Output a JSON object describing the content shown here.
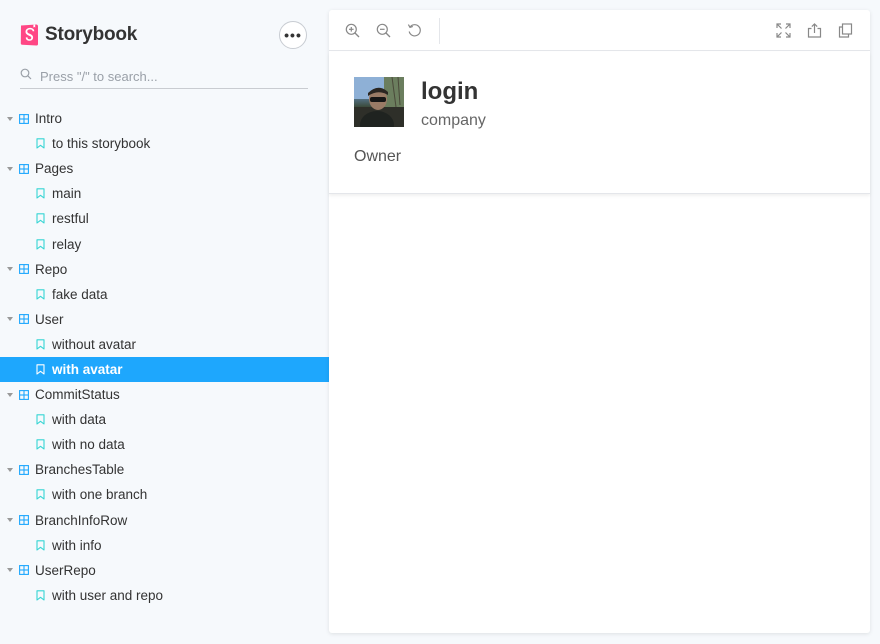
{
  "brand": {
    "title": "Storybook",
    "color": "#ff4785"
  },
  "menu": {
    "label": "•••"
  },
  "search": {
    "placeholder": "Press \"/\" to search..."
  },
  "accent": "#1ea7fd",
  "tree": [
    {
      "type": "group",
      "label": "Intro"
    },
    {
      "type": "story",
      "label": "to this storybook"
    },
    {
      "type": "group",
      "label": "Pages"
    },
    {
      "type": "story",
      "label": "main"
    },
    {
      "type": "story",
      "label": "restful"
    },
    {
      "type": "story",
      "label": "relay"
    },
    {
      "type": "group",
      "label": "Repo"
    },
    {
      "type": "story",
      "label": "fake data"
    },
    {
      "type": "group",
      "label": "User"
    },
    {
      "type": "story",
      "label": "without avatar"
    },
    {
      "type": "story",
      "label": "with avatar",
      "selected": true
    },
    {
      "type": "group",
      "label": "CommitStatus"
    },
    {
      "type": "story",
      "label": "with data"
    },
    {
      "type": "story",
      "label": "with no data"
    },
    {
      "type": "group",
      "label": "BranchesTable"
    },
    {
      "type": "story",
      "label": "with one branch"
    },
    {
      "type": "group",
      "label": "BranchInfoRow"
    },
    {
      "type": "story",
      "label": "with info"
    },
    {
      "type": "group",
      "label": "UserRepo"
    },
    {
      "type": "story",
      "label": "with user and repo"
    }
  ],
  "toolbar": {
    "left": [
      "zoom-in-icon",
      "zoom-out-icon",
      "reset-zoom-icon"
    ],
    "right": [
      "fullscreen-icon",
      "share-icon",
      "copy-icon"
    ]
  },
  "preview": {
    "login": "login",
    "company": "company",
    "role": "Owner"
  }
}
